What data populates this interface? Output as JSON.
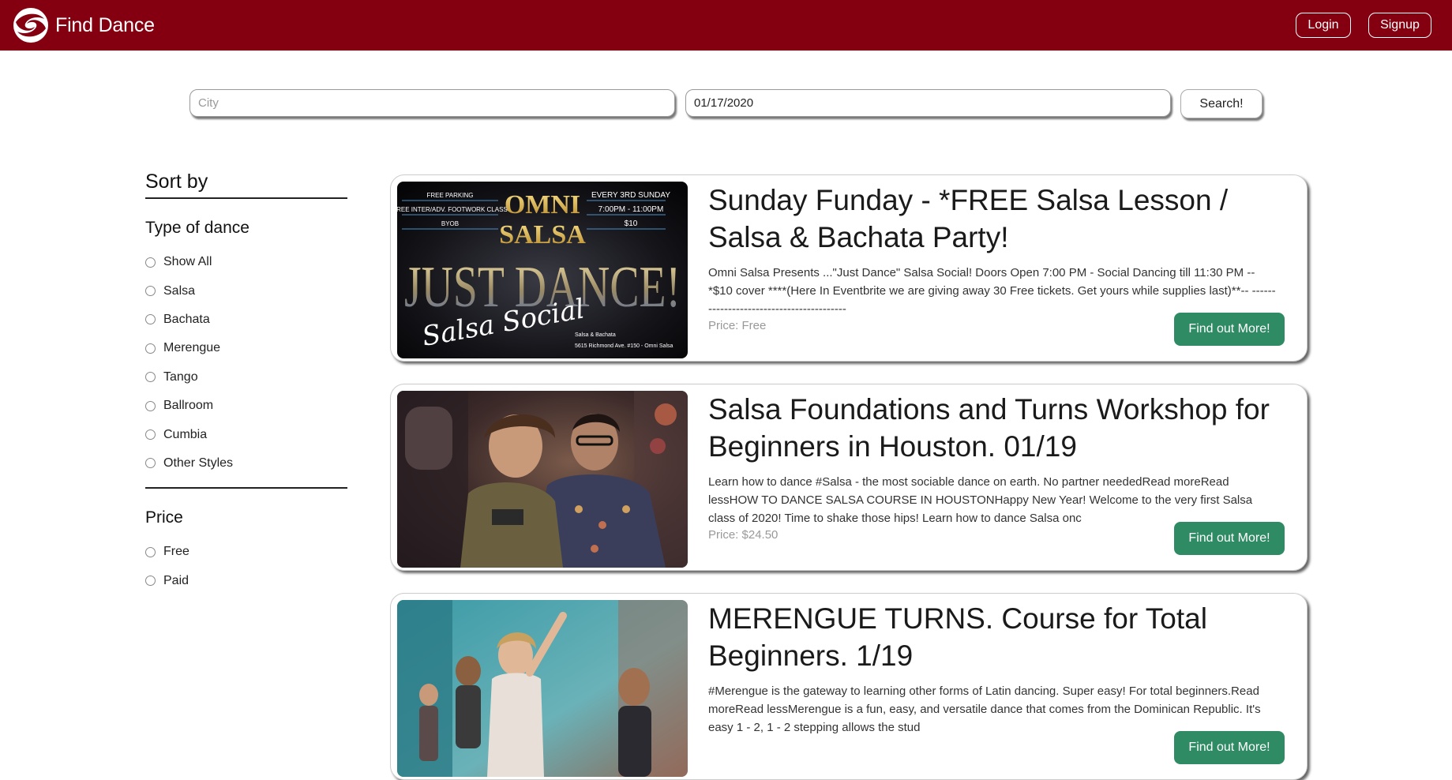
{
  "header": {
    "brand": "Find Dance",
    "login_label": "Login",
    "signup_label": "Signup",
    "bg_color": "#840010"
  },
  "search": {
    "city_placeholder": "City",
    "date_value": "01/17/2020",
    "button_label": "Search!"
  },
  "sidebar": {
    "title": "Sort by",
    "dance_heading": "Type of dance",
    "dance_options": [
      "Show All",
      "Salsa",
      "Bachata",
      "Merengue",
      "Tango",
      "Ballroom",
      "Cumbia",
      "Other Styles"
    ],
    "price_heading": "Price",
    "price_options": [
      "Free",
      "Paid"
    ]
  },
  "events": [
    {
      "title": "Sunday Funday - *FREE Salsa Lesson / Salsa & Bachata Party!",
      "description": "Omni Salsa Presents ...\"Just Dance\" Salsa Social! Doors Open 7:00 PM - Social Dancing till 11:30 PM -- *$10 cover ****(Here In Eventbrite we are giving away 30 Free tickets. Get yours while supplies last)**-- -----------------------------------------",
      "price": "Price: Free",
      "button": "Find out More!",
      "image": {
        "top_left": [
          "FREE PARKING",
          "FREE INTER/ADV. FOOTWORK CLASS",
          "BYOB"
        ],
        "brand_line1": "OMNI",
        "brand_line2": "SALSA",
        "top_right": [
          "EVERY 3RD SUNDAY",
          "7:00PM - 11:00PM",
          "$10"
        ],
        "headline": "JUST DANCE!",
        "script": "Salsa Social",
        "footer_line1": "Salsa & Bachata",
        "footer_line2": "5615 Richmond Ave. #150 - Omni Salsa"
      }
    },
    {
      "title": "Salsa Foundations and Turns Workshop for Beginners in Houston. 01/19",
      "description": "Learn how to dance #Salsa - the most sociable dance on earth. No partner neededRead moreRead lessHOW TO DANCE SALSA COURSE IN HOUSTONHappy New Year! Welcome to the very first Salsa class of 2020! Time to shake those hips! Learn how to dance Salsa onc",
      "price": "Price: $24.50",
      "button": "Find out More!"
    },
    {
      "title": "MERENGUE TURNS. Course for Total Beginners. 1/19",
      "description": "#Merengue is the gateway to learning other forms of Latin dancing. Super easy! For total beginners.Read moreRead lessMerengue is a fun, easy, and versatile dance that comes from the Dominican Republic. It's easy 1 - 2, 1 - 2 stepping allows the stud",
      "price": "",
      "button": "Find out More!"
    }
  ],
  "colors": {
    "accent_green": "#2e8b63",
    "price_gray": "#999999"
  }
}
